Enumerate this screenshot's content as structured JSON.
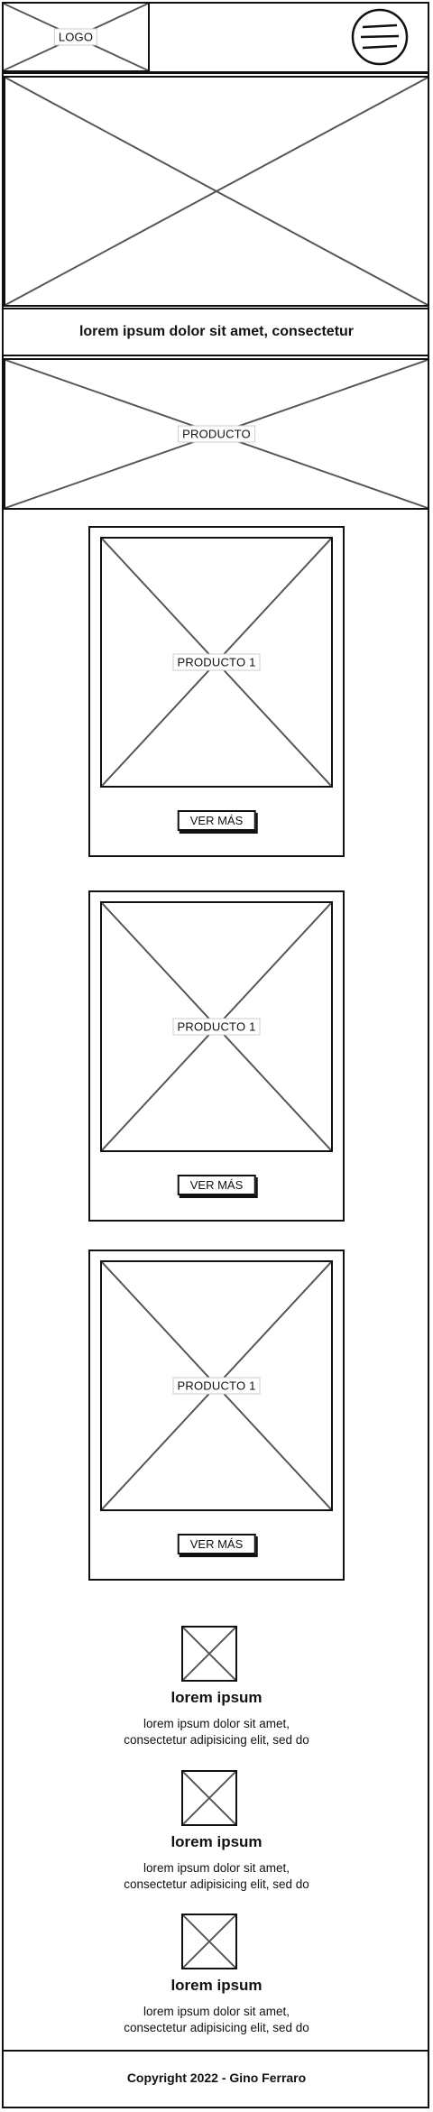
{
  "header": {
    "logo_label": "LOGO",
    "menu_icon": "hamburger-menu-icon"
  },
  "banner": {
    "tagline": "lorem ipsum dolor sit amet, consectetur"
  },
  "product_banner": {
    "label": "PRODUCTO"
  },
  "products": [
    {
      "label": "PRODUCTO 1",
      "button": "VER MÁS"
    },
    {
      "label": "PRODUCTO 1",
      "button": "VER MÁS"
    },
    {
      "label": "PRODUCTO 1",
      "button": "VER MÁS"
    }
  ],
  "features": [
    {
      "title": "lorem ipsum",
      "line1": "lorem ipsum dolor sit amet,",
      "line2": "consectetur adipisicing elit, sed do"
    },
    {
      "title": "lorem ipsum",
      "line1": "lorem ipsum dolor sit amet,",
      "line2": "consectetur adipisicing elit, sed do"
    },
    {
      "title": "lorem ipsum",
      "line1": "lorem ipsum dolor sit amet,",
      "line2": "consectetur adipisicing elit, sed do"
    }
  ],
  "footer": {
    "copyright": "Copyright 2022 - Gino Ferraro"
  }
}
